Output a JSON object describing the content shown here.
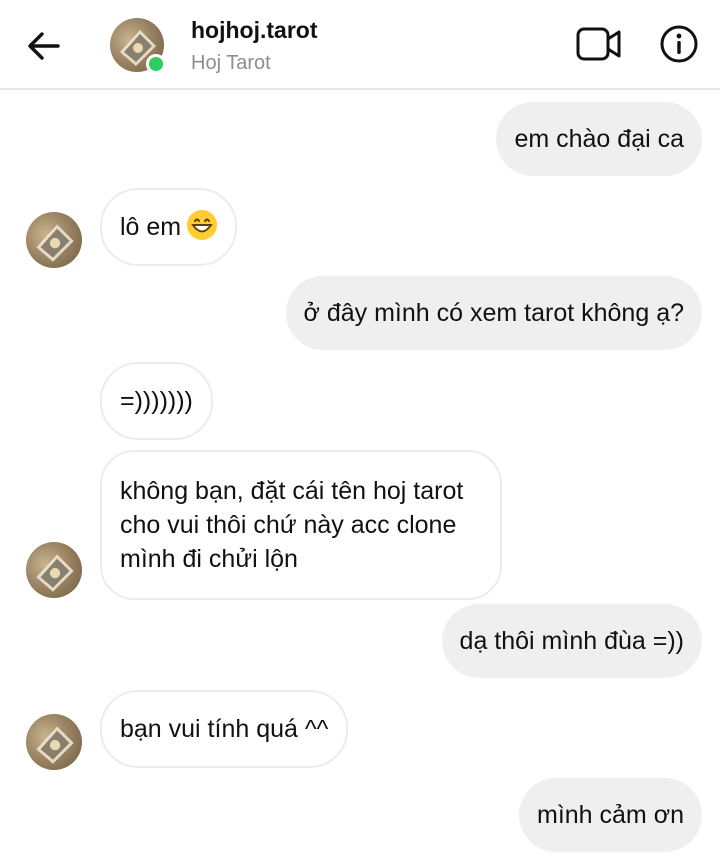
{
  "header": {
    "username": "hojhoj.tarot",
    "display_name": "Hoj Tarot",
    "back_icon": "arrow-left-icon",
    "video_icon": "video-call-icon",
    "info_icon": "info-icon",
    "online_color": "#2ecc5f"
  },
  "messages": [
    {
      "sender": "me",
      "text": "em chào đại ca"
    },
    {
      "sender": "them",
      "text": "lô em",
      "emoji": "grinning-face-icon"
    },
    {
      "sender": "me",
      "text": "ở đây mình có xem tarot không ạ?"
    },
    {
      "sender": "them",
      "text": "=)))))))"
    },
    {
      "sender": "them",
      "text": "không bạn, đặt cái tên hoj tarot cho vui thôi chứ này acc clone mình đi chửi lộn"
    },
    {
      "sender": "me",
      "text": "dạ thôi mình đùa =))"
    },
    {
      "sender": "them",
      "text": "bạn vui tính quá ^^"
    },
    {
      "sender": "me",
      "text": "mình cảm ơn"
    }
  ],
  "colors": {
    "outgoing_bubble": "#efefef",
    "incoming_bubble": "#ffffff",
    "incoming_border": "#ececec",
    "secondary_text": "#8e8e8e"
  }
}
